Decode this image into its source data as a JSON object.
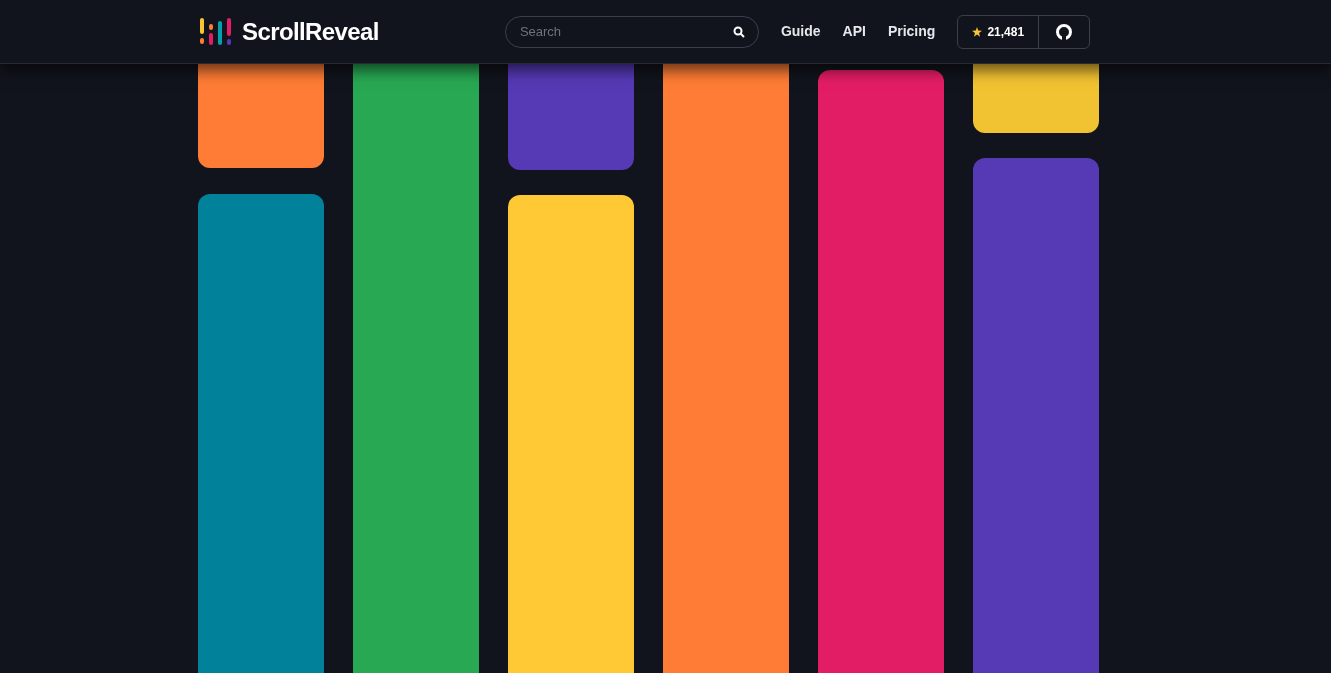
{
  "header": {
    "logo": "ScrollReveal",
    "search": {
      "placeholder": "Search"
    },
    "nav": [
      "Guide",
      "API",
      "Pricing"
    ],
    "stars": "21,481"
  },
  "columns": [
    {
      "blocks": [
        {
          "color": "#fe7c35"
        },
        {
          "color": "#01819a"
        }
      ]
    },
    {
      "blocks": [
        {
          "color": "#28a853"
        }
      ]
    },
    {
      "blocks": [
        {
          "color": "#5539b5"
        },
        {
          "color": "#fec935"
        }
      ]
    },
    {
      "blocks": [
        {
          "color": "#fe7c35"
        }
      ]
    },
    {
      "blocks": [
        {
          "color": "#e31d65"
        }
      ]
    },
    {
      "blocks": [
        {
          "color": "#f1c232"
        },
        {
          "color": "#5539b5"
        }
      ]
    }
  ]
}
